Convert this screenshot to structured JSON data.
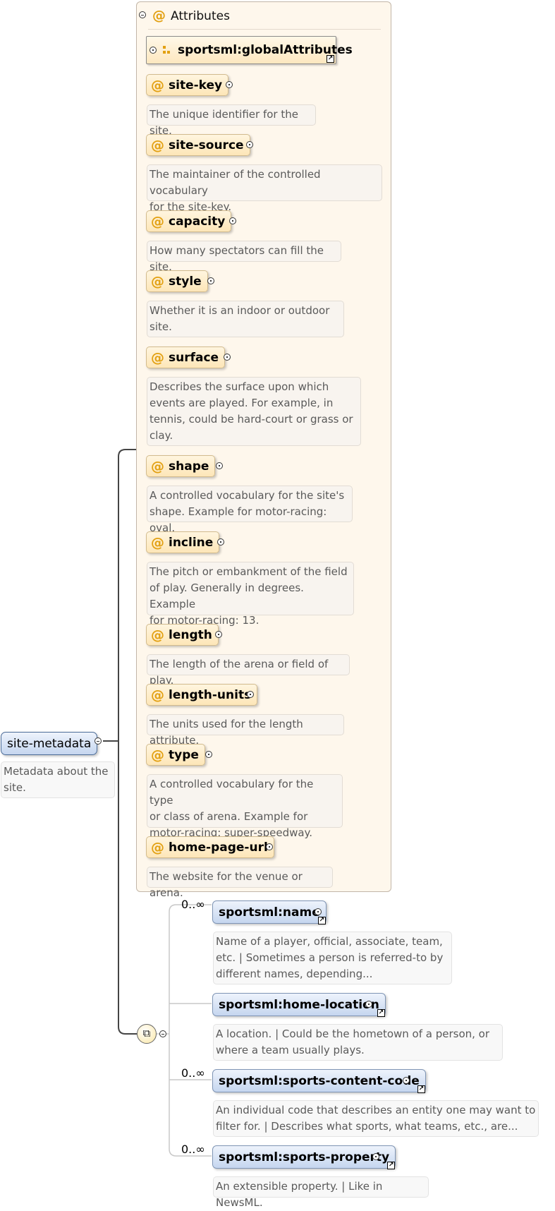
{
  "root": {
    "name": "site-metadata",
    "description": [
      "Metadata about the",
      "site."
    ]
  },
  "attributes_group": {
    "title": "Attributes",
    "global_ref": "sportsml:globalAttributes",
    "items": [
      {
        "name": "site-key",
        "description": [
          "The unique identifier for the site."
        ]
      },
      {
        "name": "site-source",
        "description": [
          "The maintainer of the controlled vocabulary",
          "for the site-key."
        ]
      },
      {
        "name": "capacity",
        "description": [
          "How many spectators can fill the site."
        ]
      },
      {
        "name": "style",
        "description": [
          "Whether it is an indoor or outdoor",
          "site."
        ]
      },
      {
        "name": "surface",
        "description": [
          "Describes the surface upon which",
          "events are played. For example, in",
          "tennis, could be hard-court or grass or",
          "clay."
        ]
      },
      {
        "name": "shape",
        "description": [
          "A controlled vocabulary for the site's",
          "shape. Example for motor-racing: oval."
        ]
      },
      {
        "name": "incline",
        "description": [
          "The pitch or embankment of the field",
          "of play. Generally in degrees. Example",
          "for motor-racing: 13."
        ]
      },
      {
        "name": "length",
        "description": [
          "The length of the arena or field of play."
        ]
      },
      {
        "name": "length-units",
        "description": [
          "The units used for the length attribute."
        ]
      },
      {
        "name": "type",
        "description": [
          "A controlled vocabulary for the type",
          "or class of arena. Example for",
          "motor-racing: super-speedway."
        ]
      },
      {
        "name": "home-page-url",
        "description": [
          "The website for the venue or arena."
        ]
      }
    ]
  },
  "sequence": {
    "elements": [
      {
        "name": "sportsml:name",
        "cardinality": "0..∞",
        "description": [
          "Name of a player, official, associate, team,",
          "etc. | Sometimes a person is referred-to by",
          "different names, depending..."
        ]
      },
      {
        "name": "sportsml:home-location",
        "cardinality": "",
        "description": [
          "A location. | Could be the hometown of a person, or",
          "where a team usually plays."
        ]
      },
      {
        "name": "sportsml:sports-content-code",
        "cardinality": "0..∞",
        "description": [
          "An individual code that describes an entity one may want to",
          "filter for. | Describes what sports, what teams, etc., are..."
        ]
      },
      {
        "name": "sportsml:sports-property",
        "cardinality": "0..∞",
        "description": [
          "An extensible property. | Like in NewsML."
        ]
      }
    ]
  },
  "icons": {
    "expand": "plus-circle-icon",
    "collapse": "minus-circle-icon",
    "attribute": "at-sign-icon",
    "reference": "arrow-ref-icon",
    "sequence": "sequence-icon",
    "attribute_group": "attribute-group-icon"
  },
  "colors": {
    "attr_fill": "#fde6b8",
    "attr_accent": "#e2a012",
    "elem_fill": "#c5d6ef",
    "group_bg": "#fef7ec"
  }
}
